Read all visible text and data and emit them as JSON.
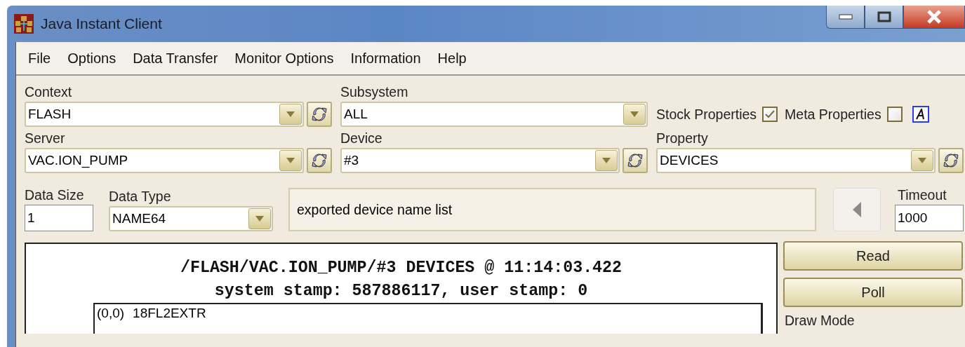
{
  "window": {
    "title": "Java Instant Client"
  },
  "menu": [
    "File",
    "Options",
    "Data Transfer",
    "Monitor Options",
    "Information",
    "Help"
  ],
  "context": {
    "label": "Context",
    "value": "FLASH"
  },
  "subsystem": {
    "label": "Subsystem",
    "value": "ALL"
  },
  "stock_properties": {
    "label": "Stock Properties",
    "checked": true
  },
  "meta_properties": {
    "label": "Meta Properties",
    "checked": false
  },
  "server": {
    "label": "Server",
    "value": "VAC.ION_PUMP"
  },
  "device": {
    "label": "Device",
    "value": "#3"
  },
  "property": {
    "label": "Property",
    "value": "DEVICES"
  },
  "data_size": {
    "label": "Data Size",
    "value": "1"
  },
  "data_type": {
    "label": "Data Type",
    "value": "NAME64"
  },
  "description": "exported device name list",
  "timeout": {
    "label": "Timeout",
    "value": "1000"
  },
  "output": {
    "header": "/FLASH/VAC.ION_PUMP/#3 DEVICES @ 11:14:03.422",
    "stamp": "system stamp: 587886117, user stamp: 0",
    "rows": [
      {
        "index": "(0,0)",
        "value": "18FL2EXTR"
      }
    ]
  },
  "buttons": [
    "Read",
    "Poll"
  ],
  "draw_mode": {
    "label": "Draw Mode"
  }
}
